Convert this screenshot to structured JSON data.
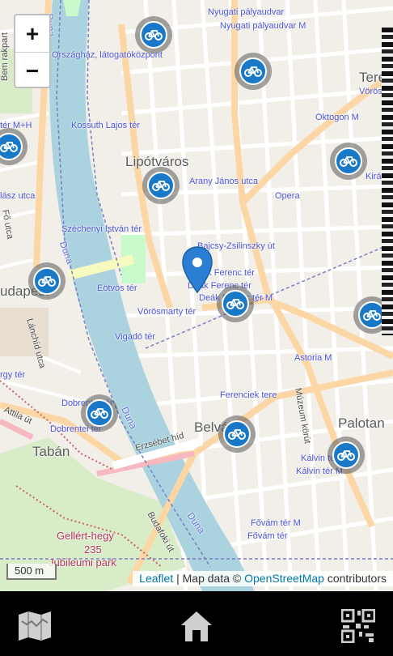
{
  "map": {
    "zoom_in": "+",
    "zoom_out": "−",
    "scale": "500 m",
    "attribution": {
      "leaflet": "Leaflet",
      "separator": " | Map data © ",
      "osm": "OpenStreetMap",
      "suffix": " contributors"
    },
    "labels": {
      "lipotvaros": "Lipótváros",
      "terez": "Teréz",
      "budapest": "udapest",
      "taban": "Tabán",
      "palotan": "Palotan",
      "belvaros": "Belváros",
      "bem_rakpart": "Bem rakpart",
      "nyugati1": "Nyugati pályaudvar",
      "nyugati2": "Nyugati pályaudvar M",
      "orszaghaz": "Országház, látogatóközpont",
      "kossuth": "Kossuth Lajos tér",
      "kossuth_m": "tér M+H",
      "oktogon": "Oktogon M",
      "voros": "Vörös",
      "arany": "Arany János utca",
      "opera": "Opera",
      "kiraly": "Kirá",
      "halasz": "lász utca",
      "fo_utca": "Fő utca",
      "szechenyi": "Széchenyi István tér",
      "bajcsy": "Bajcsy-Zsilinszky út",
      "deak1": "Deák Ferenc tér",
      "deak2": "Deák Ferenc tér",
      "deak_m": "Deák Ferenc tér M",
      "eotvos": "Eötvös tér",
      "vorosmarty": "Vörösmarty tér",
      "vigado": "Vigadó tér",
      "lanchid": "Lánchíd utca",
      "astoria": "Astoria M",
      "ferenciek": "Ferenciek tere",
      "muzeum": "Múzeum körút",
      "dobrentei1": "Dobrentei tér",
      "dobrentei2": "Dobrentei tér",
      "erzsebet": "Erzsébet híd",
      "attila": "Attila út",
      "kalvin1": "Kálvin tér",
      "kalvin2": "Kálvin tér M",
      "fovam1": "Fővám tér M",
      "fovam2": "Fővám tér",
      "gellert": "Gellért-hegy",
      "gellert_h": "235",
      "jubileumi": "Jubileumi park",
      "budafoki": "Budafoki út",
      "duna1": "Duna",
      "duna2": "Duna",
      "duna3": "Duna",
      "duna4": "Duna",
      "rgy": "rgy tér"
    }
  },
  "colors": {
    "station": "#1a78c8",
    "pin": "#2a7fd4",
    "river": "#aad3df",
    "major_road": "#fcd6a4",
    "park": "#c8facc"
  },
  "icons": {
    "station": "bicycle-icon",
    "pin": "location-pin-icon",
    "nav_map": "map-icon",
    "nav_home": "home-icon",
    "nav_qr": "qr-code-icon"
  }
}
